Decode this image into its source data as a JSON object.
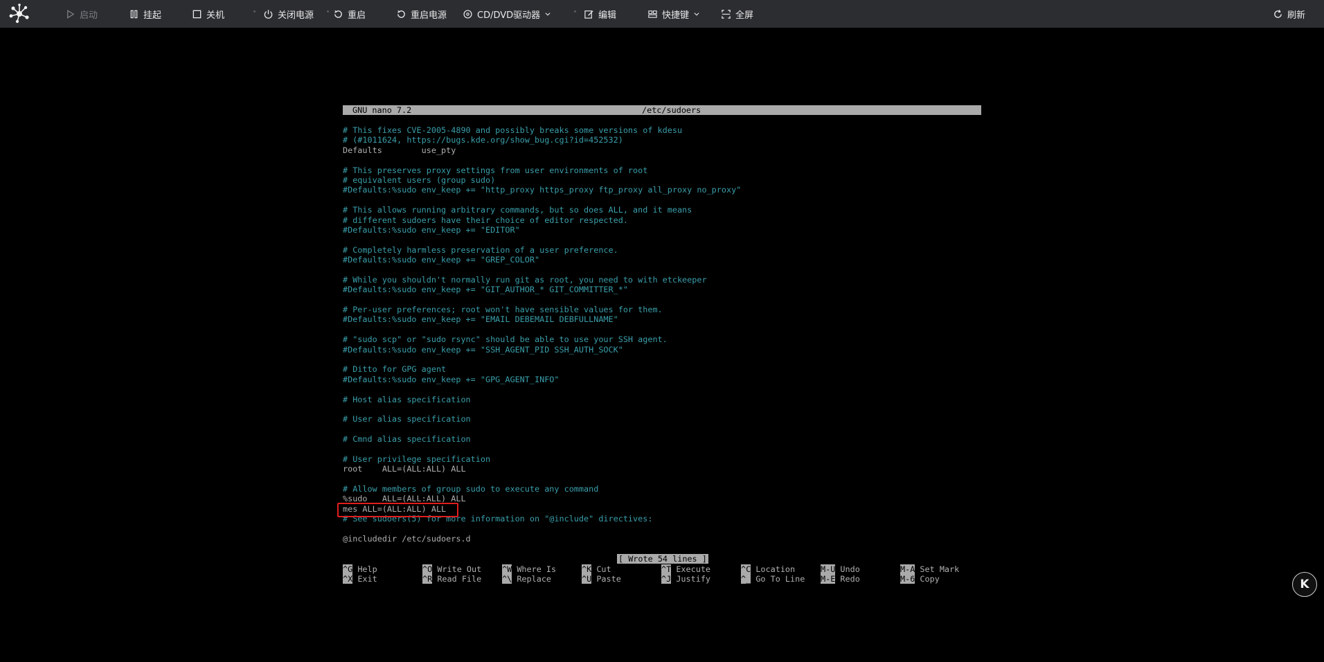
{
  "toolbar": {
    "start": "启动",
    "suspend": "挂起",
    "shutdown": "关机",
    "power_off": "关闭电源",
    "restart": "重启",
    "power_cycle": "重启电源",
    "cd_dvd": "CD/DVD驱动器",
    "edit": "编辑",
    "shortcuts": "快捷键",
    "fullscreen": "全屏",
    "refresh": "刷新"
  },
  "nano": {
    "version": "GNU nano 7.2",
    "filename": "/etc/sudoers",
    "status_message": "[ Wrote 54 lines ]",
    "lines": [
      {
        "text": "# This fixes CVE-2005-4890 and possibly breaks some versions of kdesu",
        "type": "comment"
      },
      {
        "text": "# (#1011624, https://bugs.kde.org/show_bug.cgi?id=452532)",
        "type": "comment"
      },
      {
        "text": "Defaults        use_pty",
        "type": "plain"
      },
      {
        "text": "",
        "type": "plain"
      },
      {
        "text": "# This preserves proxy settings from user environments of root",
        "type": "comment"
      },
      {
        "text": "# equivalent users (group sudo)",
        "type": "comment"
      },
      {
        "text": "#Defaults:%sudo env_keep += \"http_proxy https_proxy ftp_proxy all_proxy no_proxy\"",
        "type": "comment"
      },
      {
        "text": "",
        "type": "plain"
      },
      {
        "text": "# This allows running arbitrary commands, but so does ALL, and it means",
        "type": "comment"
      },
      {
        "text": "# different sudoers have their choice of editor respected.",
        "type": "comment"
      },
      {
        "text": "#Defaults:%sudo env_keep += \"EDITOR\"",
        "type": "comment"
      },
      {
        "text": "",
        "type": "plain"
      },
      {
        "text": "# Completely harmless preservation of a user preference.",
        "type": "comment"
      },
      {
        "text": "#Defaults:%sudo env_keep += \"GREP_COLOR\"",
        "type": "comment"
      },
      {
        "text": "",
        "type": "plain"
      },
      {
        "text": "# While you shouldn't normally run git as root, you need to with etckeeper",
        "type": "comment"
      },
      {
        "text": "#Defaults:%sudo env_keep += \"GIT_AUTHOR_* GIT_COMMITTER_*\"",
        "type": "comment"
      },
      {
        "text": "",
        "type": "plain"
      },
      {
        "text": "# Per-user preferences; root won't have sensible values for them.",
        "type": "comment"
      },
      {
        "text": "#Defaults:%sudo env_keep += \"EMAIL DEBEMAIL DEBFULLNAME\"",
        "type": "comment"
      },
      {
        "text": "",
        "type": "plain"
      },
      {
        "text": "# \"sudo scp\" or \"sudo rsync\" should be able to use your SSH agent.",
        "type": "comment"
      },
      {
        "text": "#Defaults:%sudo env_keep += \"SSH_AGENT_PID SSH_AUTH_SOCK\"",
        "type": "comment"
      },
      {
        "text": "",
        "type": "plain"
      },
      {
        "text": "# Ditto for GPG agent",
        "type": "comment"
      },
      {
        "text": "#Defaults:%sudo env_keep += \"GPG_AGENT_INFO\"",
        "type": "comment"
      },
      {
        "text": "",
        "type": "plain"
      },
      {
        "text": "# Host alias specification",
        "type": "comment"
      },
      {
        "text": "",
        "type": "plain"
      },
      {
        "text": "# User alias specification",
        "type": "comment"
      },
      {
        "text": "",
        "type": "plain"
      },
      {
        "text": "# Cmnd alias specification",
        "type": "comment"
      },
      {
        "text": "",
        "type": "plain"
      },
      {
        "text": "# User privilege specification",
        "type": "comment"
      },
      {
        "text": "root    ALL=(ALL:ALL) ALL",
        "type": "plain"
      },
      {
        "text": "",
        "type": "plain"
      },
      {
        "text": "# Allow members of group sudo to execute any command",
        "type": "comment"
      },
      {
        "text": "%sudo   ALL=(ALL:ALL) ALL",
        "type": "plain"
      },
      {
        "text": "mes ALL=(ALL:ALL) ALL",
        "type": "plain"
      },
      {
        "text": "# See sudoers(5) for more information on \"@include\" directives:",
        "type": "comment"
      },
      {
        "text": "",
        "type": "plain"
      },
      {
        "text": "@includedir /etc/sudoers.d",
        "type": "plain"
      }
    ],
    "shortcuts": [
      {
        "key": "^G",
        "label": "Help"
      },
      {
        "key": "^X",
        "label": "Exit"
      },
      {
        "key": "^O",
        "label": "Write Out"
      },
      {
        "key": "^R",
        "label": "Read File"
      },
      {
        "key": "^W",
        "label": "Where Is"
      },
      {
        "key": "^\\",
        "label": "Replace"
      },
      {
        "key": "^K",
        "label": "Cut"
      },
      {
        "key": "^U",
        "label": "Paste"
      },
      {
        "key": "^T",
        "label": "Execute"
      },
      {
        "key": "^J",
        "label": "Justify"
      },
      {
        "key": "^C",
        "label": "Location"
      },
      {
        "key": "^_",
        "label": "Go To Line"
      },
      {
        "key": "M-U",
        "label": "Undo"
      },
      {
        "key": "M-E",
        "label": "Redo"
      },
      {
        "key": "M-A",
        "label": "Set Mark"
      },
      {
        "key": "M-6",
        "label": "Copy"
      }
    ]
  },
  "badge": {
    "letter": "K"
  },
  "colors": {
    "toolbar_bg": "#2b2d31",
    "comment": "#3a9fab",
    "highlight": "#e21d1d"
  }
}
